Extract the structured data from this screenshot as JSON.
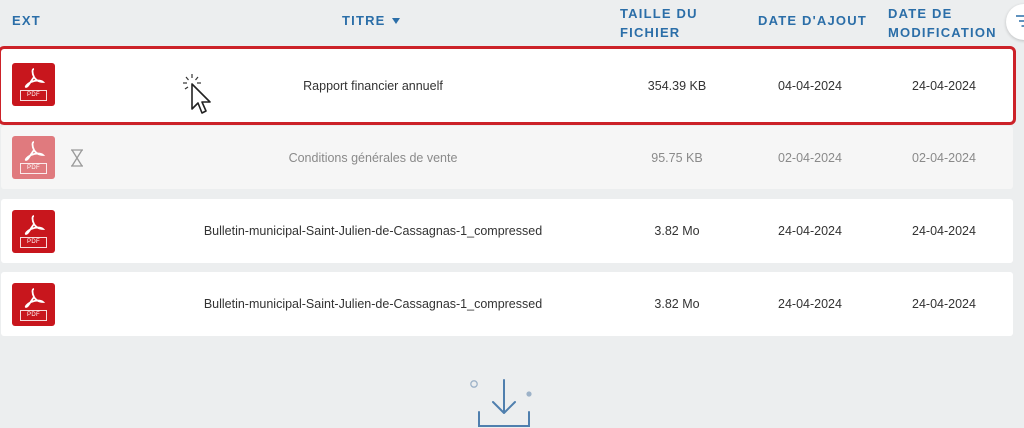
{
  "header": {
    "ext": "EXT",
    "titre": "TITRE",
    "taille_line1": "TAILLE DU",
    "taille_line2": "FICHIER",
    "date_ajout": "DATE D'AJOUT",
    "date_modif_line1": "DATE DE",
    "date_modif_line2": "MODIFICATION"
  },
  "colors": {
    "header_text": "#2b6ea8",
    "pdf_red": "#c8161d",
    "selection_border": "#cc2229",
    "background": "#eceeef"
  },
  "icons": {
    "sort": "caret-down-icon",
    "filter": "filter-icon",
    "file": "pdf-file-icon",
    "pending": "hourglass-icon",
    "pointer": "mouse-pointer-icon",
    "download": "download-icon"
  },
  "files": [
    {
      "pdf_label": "PDF",
      "title": "Rapport financier annuelf",
      "size": "354.39 KB",
      "date_added": "04-04-2024",
      "date_modified": "24-04-2024"
    },
    {
      "pdf_label": "PDF",
      "title": "Conditions générales de vente",
      "size": "95.75 KB",
      "date_added": "02-04-2024",
      "date_modified": "02-04-2024"
    },
    {
      "pdf_label": "PDF",
      "title": "Bulletin-municipal-Saint-Julien-de-Cassagnas-1_compressed",
      "size": "3.82 Mo",
      "date_added": "24-04-2024",
      "date_modified": "24-04-2024"
    },
    {
      "pdf_label": "PDF",
      "title": "Bulletin-municipal-Saint-Julien-de-Cassagnas-1_compressed",
      "size": "3.82 Mo",
      "date_added": "24-04-2024",
      "date_modified": "24-04-2024"
    }
  ]
}
